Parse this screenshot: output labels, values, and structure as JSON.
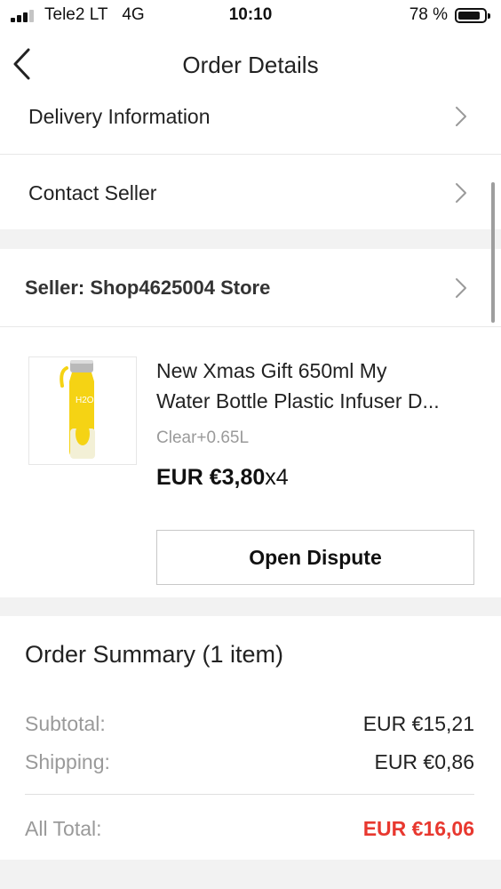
{
  "status_bar": {
    "carrier": "Tele2 LT",
    "network": "4G",
    "time": "10:10",
    "battery_percent": "78 %",
    "battery_level": 0.78
  },
  "nav": {
    "title": "Order Details",
    "back_icon": "chevron-left-icon"
  },
  "rows": {
    "delivery": "Delivery Information",
    "contact": "Contact Seller",
    "seller": "Seller: Shop4625004 Store"
  },
  "product": {
    "title_line1": "New Xmas Gift 650ml My",
    "title_line2": "Water Bottle Plastic Infuser D...",
    "variant": "Clear+0.65L",
    "price": "EUR €3,80",
    "quantity": "x4",
    "thumb_label": "H2O"
  },
  "dispute_button": "Open Dispute",
  "summary": {
    "title": "Order Summary (1 item)",
    "subtotal_label": "Subtotal:",
    "subtotal_value": "EUR €15,21",
    "shipping_label": "Shipping:",
    "shipping_value": "EUR €0,86",
    "total_label": "All Total:",
    "total_value": "EUR €16,06"
  },
  "colors": {
    "accent_total": "#e8382f",
    "background": "#f2f2f2",
    "bottle_yellow": "#f5d314"
  }
}
